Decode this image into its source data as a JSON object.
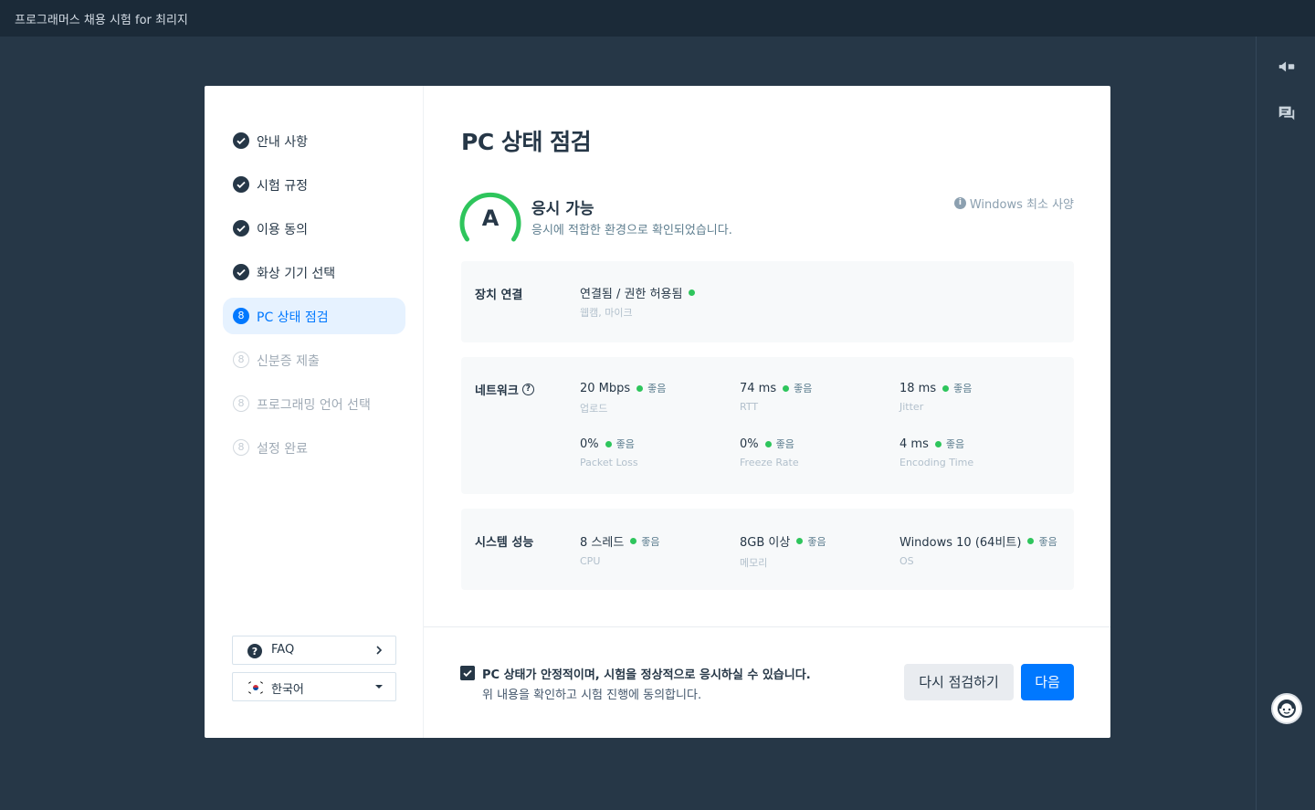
{
  "app_title": "프로그래머스 채용 시험 for 최리지",
  "right_rail": {
    "icons": [
      "megaphone-icon",
      "chat-icon",
      "support-avatar-icon"
    ]
  },
  "sidebar": {
    "steps": [
      {
        "label": "안내 사항",
        "state": "done"
      },
      {
        "label": "시험 규정",
        "state": "done"
      },
      {
        "label": "이용 동의",
        "state": "done"
      },
      {
        "label": "화상 기기 선택",
        "state": "done"
      },
      {
        "label": "PC 상태 점검",
        "state": "active",
        "number": "8"
      },
      {
        "label": "신분증 제출",
        "state": "pending",
        "number": "8"
      },
      {
        "label": "프로그래밍 언어 선택",
        "state": "pending",
        "number": "8"
      },
      {
        "label": "설정 완료",
        "state": "pending",
        "number": "8"
      }
    ],
    "faq_label": "FAQ",
    "language_label": "한국어"
  },
  "main": {
    "title": "PC 상태 점검",
    "grade": "A",
    "status_title": "응시 가능",
    "status_sub": "응시에 적합한 환경으로 확인되었습니다.",
    "spec_link": "Windows 최소 사양",
    "device": {
      "title": "장치 연결",
      "value": "연결됨 / 권한 허용됨",
      "label": "웹캠, 마이크"
    },
    "network": {
      "title": "네트워크",
      "metrics": [
        {
          "value": "20 Mbps",
          "status": "좋음",
          "label": "업로드"
        },
        {
          "value": "74 ms",
          "status": "좋음",
          "label": "RTT"
        },
        {
          "value": "18 ms",
          "status": "좋음",
          "label": "Jitter"
        },
        {
          "value": "0%",
          "status": "좋음",
          "label": "Packet Loss"
        },
        {
          "value": "0%",
          "status": "좋음",
          "label": "Freeze Rate"
        },
        {
          "value": "4 ms",
          "status": "좋음",
          "label": "Encoding Time"
        }
      ]
    },
    "system": {
      "title": "시스템 성능",
      "metrics": [
        {
          "value": "8 스레드",
          "status": "좋음",
          "label": "CPU"
        },
        {
          "value": "8GB 이상",
          "status": "좋음",
          "label": "메모리"
        },
        {
          "value": "Windows 10 (64비트)",
          "status": "좋음",
          "label": "OS"
        }
      ]
    },
    "agree": {
      "checked": true,
      "main": "PC 상태가 안정적이며, 시험을 정상적으로 응시하실 수 있습니다.",
      "sub": "위 내용을 확인하고 시험 진행에 동의합니다."
    },
    "recheck_label": "다시 점검하기",
    "next_label": "다음"
  },
  "colors": {
    "background": "#263747",
    "topbar": "#1b2a38",
    "accent": "#0078ff",
    "good": "#2ec55c",
    "active_step_bg": "#e6f2ff"
  }
}
